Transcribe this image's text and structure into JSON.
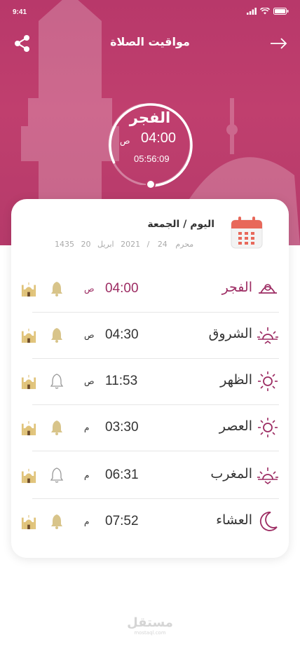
{
  "status_bar": {
    "time": "9:41"
  },
  "header": {
    "title": "مواقيت الصلاة",
    "share_icon": "share-icon",
    "back_icon": "arrow-right-icon"
  },
  "current_prayer": {
    "name": "الفجر",
    "time": "04:00",
    "ampm": "ص",
    "countdown": "05:56:09",
    "progress": 0.82
  },
  "date_card": {
    "day_label": "اليوم / الجمعة",
    "gregorian_day": "20",
    "gregorian_month": "ابريل",
    "gregorian_year": "2021",
    "separator": "/",
    "hijri_day": "24",
    "hijri_month": "محرم",
    "hijri_year": "1435",
    "icon": "calendar-icon"
  },
  "prayers": [
    {
      "name": "الفجر",
      "time": "04:00",
      "ampm": "ص",
      "icon": "fajr-icon",
      "bell": "on",
      "active": true
    },
    {
      "name": "الشروق",
      "time": "04:30",
      "ampm": "ص",
      "icon": "sunrise-icon",
      "bell": "on",
      "active": false
    },
    {
      "name": "الظهر",
      "time": "11:53",
      "ampm": "ص",
      "icon": "sun-icon",
      "bell": "off",
      "active": false
    },
    {
      "name": "العصر",
      "time": "03:30",
      "ampm": "م",
      "icon": "sun-icon",
      "bell": "on",
      "active": false
    },
    {
      "name": "المغرب",
      "time": "06:31",
      "ampm": "م",
      "icon": "sunset-icon",
      "bell": "off",
      "active": false
    },
    {
      "name": "العشاء",
      "time": "07:52",
      "ampm": "م",
      "icon": "moon-icon",
      "bell": "on",
      "active": false
    }
  ],
  "watermark": {
    "text": "مستقل",
    "sub": "mostaql.com"
  },
  "colors": {
    "accent": "#9c2b62",
    "header_bg": "#b8386a",
    "bell_on": "#d8c48a",
    "bell_off": "#999999",
    "calendar": "#e8685a"
  }
}
